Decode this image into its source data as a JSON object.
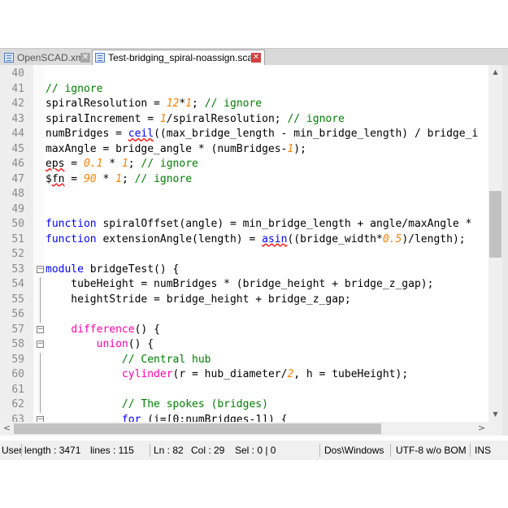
{
  "tabs": [
    {
      "label": "OpenSCAD.xml",
      "active": false
    },
    {
      "label": "Test-bridging_spiral-noassign.scad",
      "active": true
    }
  ],
  "editor": {
    "lines": [
      {
        "n": "40",
        "tokens": []
      },
      {
        "n": "41",
        "tokens": [
          {
            "t": "// ignore",
            "c": "c"
          }
        ]
      },
      {
        "n": "42",
        "tokens": [
          {
            "t": "spiralResolution = "
          },
          {
            "t": "12",
            "c": "n"
          },
          {
            "t": "*"
          },
          {
            "t": "1",
            "c": "n"
          },
          {
            "t": "; "
          },
          {
            "t": "// ignore",
            "c": "c"
          }
        ]
      },
      {
        "n": "43",
        "tokens": [
          {
            "t": "spiralIncrement = "
          },
          {
            "t": "1",
            "c": "n"
          },
          {
            "t": "/spiralResolution; "
          },
          {
            "t": "// ignore",
            "c": "c"
          }
        ]
      },
      {
        "n": "44",
        "tokens": [
          {
            "t": "numBridges = "
          },
          {
            "t": "ceil",
            "c": "fn"
          },
          {
            "t": "((max_bridge_length - min_bridge_length) / bridge_i"
          }
        ]
      },
      {
        "n": "45",
        "tokens": [
          {
            "t": "maxAngle = bridge_angle * (numBridges-"
          },
          {
            "t": "1",
            "c": "n"
          },
          {
            "t": ");"
          }
        ]
      },
      {
        "n": "46",
        "tokens": [
          {
            "t": "eps",
            "c": "sq"
          },
          {
            "t": " = "
          },
          {
            "t": "0.1",
            "c": "n"
          },
          {
            "t": " * "
          },
          {
            "t": "1",
            "c": "n"
          },
          {
            "t": "; "
          },
          {
            "t": "// ignore",
            "c": "c"
          }
        ]
      },
      {
        "n": "47",
        "tokens": [
          {
            "t": "$"
          },
          {
            "t": "fn",
            "c": "sq"
          },
          {
            "t": " = "
          },
          {
            "t": "90",
            "c": "n"
          },
          {
            "t": " * "
          },
          {
            "t": "1",
            "c": "n"
          },
          {
            "t": "; "
          },
          {
            "t": "// ignore",
            "c": "c"
          }
        ]
      },
      {
        "n": "48",
        "tokens": []
      },
      {
        "n": "49",
        "tokens": []
      },
      {
        "n": "50",
        "tokens": [
          {
            "t": "function",
            "c": "k"
          },
          {
            "t": " spiralOffset(angle) = min_bridge_length + angle/maxAngle *"
          }
        ]
      },
      {
        "n": "51",
        "tokens": [
          {
            "t": "function",
            "c": "k"
          },
          {
            "t": " extensionAngle(length) = "
          },
          {
            "t": "asin",
            "c": "fn"
          },
          {
            "t": "((bridge_width*"
          },
          {
            "t": "0.5",
            "c": "n"
          },
          {
            "t": ")/length);"
          }
        ]
      },
      {
        "n": "52",
        "tokens": []
      },
      {
        "n": "53",
        "fold": "box",
        "tokens": [
          {
            "t": "module",
            "c": "k"
          },
          {
            "t": " bridgeTest() {"
          }
        ]
      },
      {
        "n": "54",
        "fold": "line",
        "tokens": [
          {
            "t": "    tubeHeight = numBridges * (bridge_height + bridge_z_gap);"
          }
        ]
      },
      {
        "n": "55",
        "fold": "line",
        "tokens": [
          {
            "t": "    heightStride = bridge_height + bridge_z_gap;"
          }
        ]
      },
      {
        "n": "56",
        "fold": "line",
        "tokens": []
      },
      {
        "n": "57",
        "fold": "box",
        "tokens": [
          {
            "t": "    "
          },
          {
            "t": "difference",
            "c": "m"
          },
          {
            "t": "() {"
          }
        ]
      },
      {
        "n": "58",
        "fold": "box",
        "tokens": [
          {
            "t": "        "
          },
          {
            "t": "union",
            "c": "m"
          },
          {
            "t": "() {"
          }
        ]
      },
      {
        "n": "59",
        "fold": "line",
        "tokens": [
          {
            "t": "            "
          },
          {
            "t": "// Central hub",
            "c": "c"
          }
        ]
      },
      {
        "n": "60",
        "fold": "line",
        "tokens": [
          {
            "t": "            "
          },
          {
            "t": "cylinder",
            "c": "m"
          },
          {
            "t": "(r = hub_diameter/"
          },
          {
            "t": "2",
            "c": "n"
          },
          {
            "t": ", h = tubeHeight);"
          }
        ]
      },
      {
        "n": "61",
        "fold": "line",
        "tokens": []
      },
      {
        "n": "62",
        "fold": "line",
        "tokens": [
          {
            "t": "            "
          },
          {
            "t": "// The spokes (bridges)",
            "c": "c"
          }
        ]
      },
      {
        "n": "63",
        "fold": "box",
        "tokens": [
          {
            "t": "            "
          },
          {
            "t": "for",
            "c": "k"
          },
          {
            "t": " (i=[0:numBridges-1]) {"
          }
        ]
      }
    ]
  },
  "scroll": {
    "left_arrow": "<",
    "right_arrow": ">",
    "up_arrow": "▲",
    "down_arrow": "▼"
  },
  "status": {
    "lang": "User",
    "length": "length : 3471",
    "lines": "lines : 115",
    "ln": "Ln : 82",
    "col": "Col : 29",
    "sel": "Sel : 0 | 0",
    "eol": "Dos\\Windows",
    "enc": "UTF-8 w/o BOM",
    "mode": "INS"
  },
  "colors": {
    "keyword": "#0000ff",
    "comment": "#008000",
    "number": "#ff8000",
    "builtin": "#ff00aa"
  }
}
